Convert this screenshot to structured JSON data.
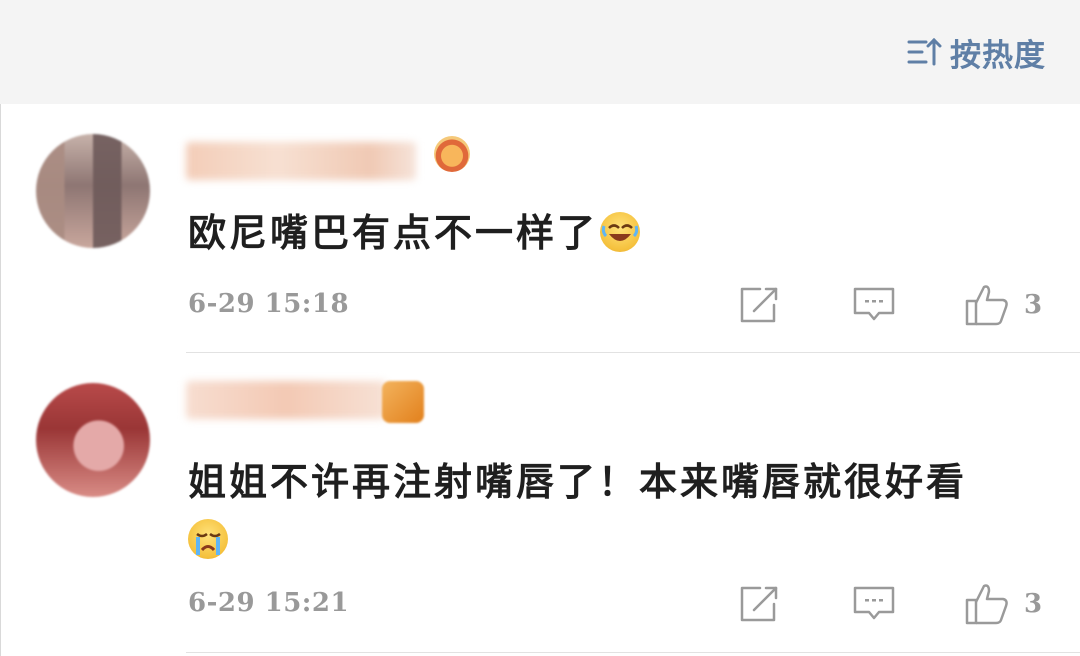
{
  "header": {
    "sort_label": "按热度",
    "sort_icon": "sort-hot-icon",
    "accent_color": "#5f7fa6"
  },
  "comments": [
    {
      "text": "欧尼嘴巴有点不一样了",
      "emoji": "laugh-cry-emoji",
      "time": "6-29 15:18",
      "likes": "3"
    },
    {
      "text": "姐姐不许再注射嘴唇了！本来嘴唇就很好看",
      "emoji": "crying-emoji",
      "time": "6-29 15:21",
      "likes": "3"
    }
  ],
  "icons": {
    "share": "share-icon",
    "comment": "comment-icon",
    "like": "like-icon"
  }
}
